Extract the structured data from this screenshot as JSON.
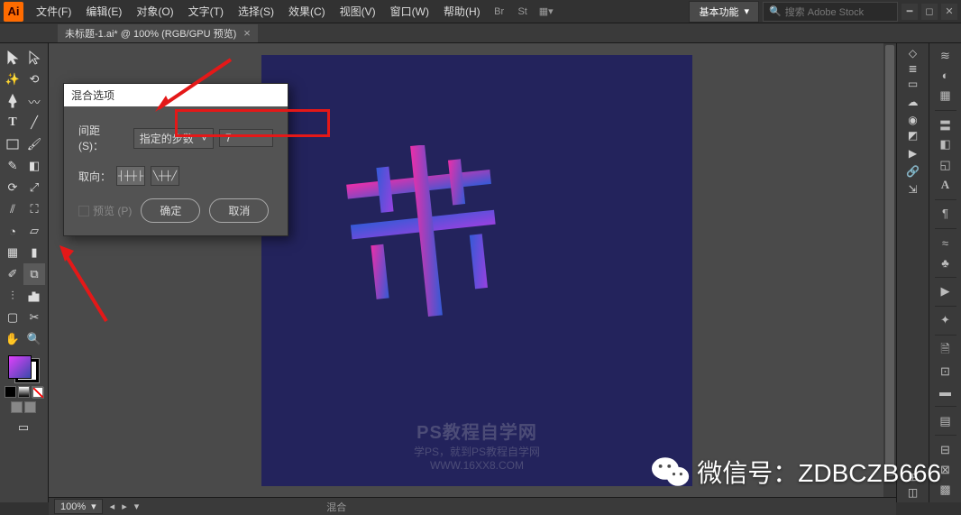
{
  "menubar": {
    "items": [
      "文件(F)",
      "编辑(E)",
      "对象(O)",
      "文字(T)",
      "选择(S)",
      "效果(C)",
      "视图(V)",
      "窗口(W)",
      "帮助(H)"
    ],
    "workspace": "基本功能",
    "search_placeholder": "搜索 Adobe Stock"
  },
  "tab": {
    "title": "未标题-1.ai* @ 100% (RGB/GPU 预览)"
  },
  "dialog": {
    "title": "混合选项",
    "spacing_label": "间距 (S)：",
    "spacing_mode": "指定的步数",
    "spacing_value": "7",
    "orient_label": "取向：",
    "preview_label": "预览 (P)",
    "ok": "确定",
    "cancel": "取消"
  },
  "status": {
    "zoom": "100%",
    "tool": "混合"
  },
  "canvas_wm": {
    "title": "PS教程自学网",
    "sub": "学PS，就到PS教程自学网",
    "url": "WWW.16XX8.COM"
  },
  "overlay": {
    "wx": "微信号：ZDBCZB666"
  },
  "left_tools": [
    "selection",
    "direct-selection",
    "magic-wand",
    "lasso",
    "pen",
    "curvature",
    "type",
    "line-segment",
    "rectangle",
    "paintbrush",
    "pencil",
    "eraser",
    "rotate",
    "scale",
    "width",
    "free-transform",
    "shape-builder",
    "perspective",
    "mesh",
    "gradient",
    "eyedropper",
    "blend",
    "symbol-sprayer",
    "column-graph",
    "artboard",
    "slice",
    "hand",
    "zoom"
  ],
  "right_icons_a": [
    "layers",
    "document",
    "libraries",
    "color",
    "color-guide",
    "swatches",
    "type-panel",
    "stroke",
    "gradient-panel",
    "transparency",
    "appearance",
    "graphic-styles",
    "symbols",
    "brushes",
    "align",
    "pathfinder",
    "transform",
    "navigator"
  ],
  "right_icons_b": [
    "panel-a",
    "panel-b",
    "panel-c",
    "panel-d",
    "panel-e",
    "panel-f"
  ]
}
